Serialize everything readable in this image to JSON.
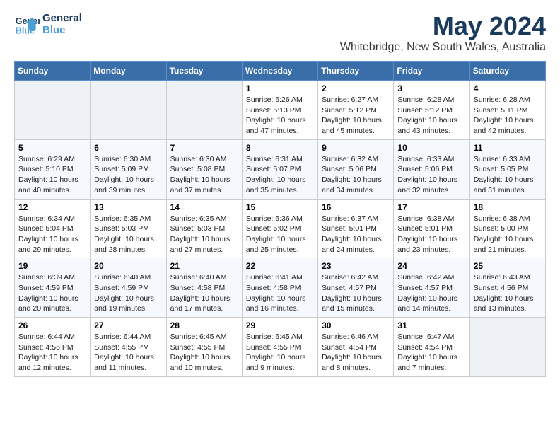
{
  "header": {
    "logo_line1": "General",
    "logo_line2": "Blue",
    "month": "May 2024",
    "location": "Whitebridge, New South Wales, Australia"
  },
  "weekdays": [
    "Sunday",
    "Monday",
    "Tuesday",
    "Wednesday",
    "Thursday",
    "Friday",
    "Saturday"
  ],
  "weeks": [
    [
      null,
      null,
      null,
      {
        "day": "1",
        "sunrise": "6:26 AM",
        "sunset": "5:13 PM",
        "daylight": "10 hours and 47 minutes."
      },
      {
        "day": "2",
        "sunrise": "6:27 AM",
        "sunset": "5:12 PM",
        "daylight": "10 hours and 45 minutes."
      },
      {
        "day": "3",
        "sunrise": "6:28 AM",
        "sunset": "5:12 PM",
        "daylight": "10 hours and 43 minutes."
      },
      {
        "day": "4",
        "sunrise": "6:28 AM",
        "sunset": "5:11 PM",
        "daylight": "10 hours and 42 minutes."
      }
    ],
    [
      {
        "day": "5",
        "sunrise": "6:29 AM",
        "sunset": "5:10 PM",
        "daylight": "10 hours and 40 minutes."
      },
      {
        "day": "6",
        "sunrise": "6:30 AM",
        "sunset": "5:09 PM",
        "daylight": "10 hours and 39 minutes."
      },
      {
        "day": "7",
        "sunrise": "6:30 AM",
        "sunset": "5:08 PM",
        "daylight": "10 hours and 37 minutes."
      },
      {
        "day": "8",
        "sunrise": "6:31 AM",
        "sunset": "5:07 PM",
        "daylight": "10 hours and 35 minutes."
      },
      {
        "day": "9",
        "sunrise": "6:32 AM",
        "sunset": "5:06 PM",
        "daylight": "10 hours and 34 minutes."
      },
      {
        "day": "10",
        "sunrise": "6:33 AM",
        "sunset": "5:06 PM",
        "daylight": "10 hours and 32 minutes."
      },
      {
        "day": "11",
        "sunrise": "6:33 AM",
        "sunset": "5:05 PM",
        "daylight": "10 hours and 31 minutes."
      }
    ],
    [
      {
        "day": "12",
        "sunrise": "6:34 AM",
        "sunset": "5:04 PM",
        "daylight": "10 hours and 29 minutes."
      },
      {
        "day": "13",
        "sunrise": "6:35 AM",
        "sunset": "5:03 PM",
        "daylight": "10 hours and 28 minutes."
      },
      {
        "day": "14",
        "sunrise": "6:35 AM",
        "sunset": "5:03 PM",
        "daylight": "10 hours and 27 minutes."
      },
      {
        "day": "15",
        "sunrise": "6:36 AM",
        "sunset": "5:02 PM",
        "daylight": "10 hours and 25 minutes."
      },
      {
        "day": "16",
        "sunrise": "6:37 AM",
        "sunset": "5:01 PM",
        "daylight": "10 hours and 24 minutes."
      },
      {
        "day": "17",
        "sunrise": "6:38 AM",
        "sunset": "5:01 PM",
        "daylight": "10 hours and 23 minutes."
      },
      {
        "day": "18",
        "sunrise": "6:38 AM",
        "sunset": "5:00 PM",
        "daylight": "10 hours and 21 minutes."
      }
    ],
    [
      {
        "day": "19",
        "sunrise": "6:39 AM",
        "sunset": "4:59 PM",
        "daylight": "10 hours and 20 minutes."
      },
      {
        "day": "20",
        "sunrise": "6:40 AM",
        "sunset": "4:59 PM",
        "daylight": "10 hours and 19 minutes."
      },
      {
        "day": "21",
        "sunrise": "6:40 AM",
        "sunset": "4:58 PM",
        "daylight": "10 hours and 17 minutes."
      },
      {
        "day": "22",
        "sunrise": "6:41 AM",
        "sunset": "4:58 PM",
        "daylight": "10 hours and 16 minutes."
      },
      {
        "day": "23",
        "sunrise": "6:42 AM",
        "sunset": "4:57 PM",
        "daylight": "10 hours and 15 minutes."
      },
      {
        "day": "24",
        "sunrise": "6:42 AM",
        "sunset": "4:57 PM",
        "daylight": "10 hours and 14 minutes."
      },
      {
        "day": "25",
        "sunrise": "6:43 AM",
        "sunset": "4:56 PM",
        "daylight": "10 hours and 13 minutes."
      }
    ],
    [
      {
        "day": "26",
        "sunrise": "6:44 AM",
        "sunset": "4:56 PM",
        "daylight": "10 hours and 12 minutes."
      },
      {
        "day": "27",
        "sunrise": "6:44 AM",
        "sunset": "4:55 PM",
        "daylight": "10 hours and 11 minutes."
      },
      {
        "day": "28",
        "sunrise": "6:45 AM",
        "sunset": "4:55 PM",
        "daylight": "10 hours and 10 minutes."
      },
      {
        "day": "29",
        "sunrise": "6:45 AM",
        "sunset": "4:55 PM",
        "daylight": "10 hours and 9 minutes."
      },
      {
        "day": "30",
        "sunrise": "6:46 AM",
        "sunset": "4:54 PM",
        "daylight": "10 hours and 8 minutes."
      },
      {
        "day": "31",
        "sunrise": "6:47 AM",
        "sunset": "4:54 PM",
        "daylight": "10 hours and 7 minutes."
      },
      null
    ]
  ],
  "labels": {
    "sunrise_prefix": "Sunrise: ",
    "sunset_prefix": "Sunset: ",
    "daylight_prefix": "Daylight: "
  }
}
